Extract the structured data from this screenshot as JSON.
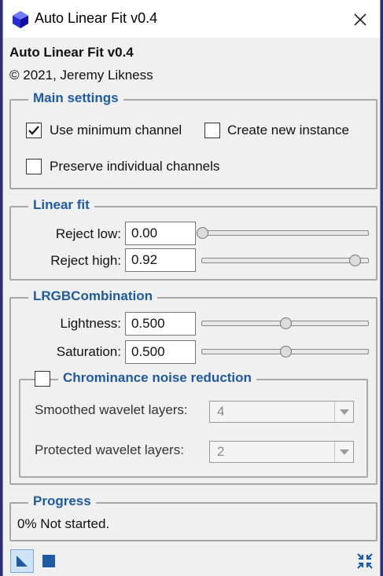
{
  "window": {
    "title": "Auto Linear Fit v0.4"
  },
  "header": {
    "title": "Auto Linear Fit v0.4",
    "copyright": "© 2021, Jeremy Likness"
  },
  "main_settings": {
    "legend": "Main settings",
    "use_min_channel": {
      "label": "Use minimum channel",
      "checked": true
    },
    "create_new_instance": {
      "label": "Create new instance",
      "checked": false
    },
    "preserve_channels": {
      "label": "Preserve individual channels",
      "checked": false
    }
  },
  "linear_fit": {
    "legend": "Linear fit",
    "reject_low": {
      "label": "Reject low:",
      "value": "0.00",
      "fraction": 0.0
    },
    "reject_high": {
      "label": "Reject high:",
      "value": "0.92",
      "fraction": 0.92
    }
  },
  "lrgb": {
    "legend": "LRGBCombination",
    "lightness": {
      "label": "Lightness:",
      "value": "0.500",
      "fraction": 0.5
    },
    "saturation": {
      "label": "Saturation:",
      "value": "0.500",
      "fraction": 0.5
    },
    "chrominance": {
      "label": "Chrominance noise reduction",
      "checked": false,
      "smoothed": {
        "label": "Smoothed wavelet layers:",
        "value": "4"
      },
      "protected": {
        "label": "Protected wavelet layers:",
        "value": "2"
      }
    }
  },
  "progress": {
    "legend": "Progress",
    "status": "0% Not started."
  },
  "colors": {
    "accent": "#1f5aa5",
    "title_bar": "#ffffff",
    "panel": "#f0f0f0"
  },
  "icons": [
    "app-logo-icon",
    "close-icon",
    "checkmark-icon",
    "new-instance-icon",
    "execute-square-icon",
    "reset-collapse-icon",
    "dropdown-arrow-icon"
  ]
}
